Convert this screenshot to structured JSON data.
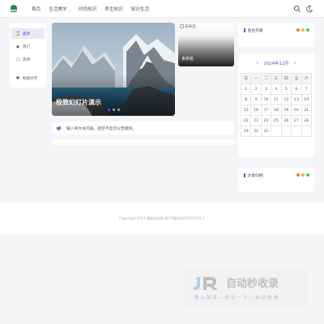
{
  "header": {
    "nav": [
      "首页",
      "生活美学",
      "时尚知识",
      "养生知识",
      "知识生活"
    ],
    "nav_caret_index": 1
  },
  "sidebar": {
    "items": [
      {
        "label": "最新",
        "icon": "hourglass-icon"
      },
      {
        "label": "热门",
        "icon": "gem-icon"
      },
      {
        "label": "热评",
        "icon": "comment-icon"
      },
      {
        "label": "标题文字",
        "icon": "heart-icon"
      }
    ]
  },
  "slider": {
    "title": "极致幻灯片演示",
    "active_dot": 0
  },
  "side_card": {
    "broken_alt": "未命名",
    "title": "未命名"
  },
  "notice": {
    "text": "输入纯文本内容，留空不显示公告模块。"
  },
  "widgets": {
    "top_title": "后台列表",
    "bottom_title": "文章归档",
    "dot_colors": [
      "#f0774a",
      "#f5b531",
      "#3fc56a"
    ]
  },
  "calendar": {
    "year_month": "2024年12月",
    "prev": "«",
    "next": "»",
    "weekdays": [
      "日",
      "一",
      "二",
      "三",
      "四",
      "五",
      "六"
    ],
    "weeks": [
      [
        "1",
        "2",
        "3",
        "4",
        "5",
        "6",
        "7"
      ],
      [
        "8",
        "9",
        "10",
        "11",
        "12",
        "13",
        "14"
      ],
      [
        "15",
        "16",
        "17",
        "18",
        "19",
        "20",
        "21"
      ],
      [
        "22",
        "23",
        "24",
        "25",
        "26",
        "27",
        "28"
      ],
      [
        "29",
        "30",
        "31",
        "",
        "",
        "",
        ""
      ]
    ]
  },
  "footer": {
    "copyright": "Copyright 2024   模板在这里     除ICP备2024010101号-1"
  },
  "watermark": {
    "big": "自动秒收录",
    "small": "做 上 链 接 — 来 访 一 次 — 自 动 收 录"
  },
  "colors": {
    "accent": "#6b4fd1",
    "logo": "#1f8a4c"
  }
}
